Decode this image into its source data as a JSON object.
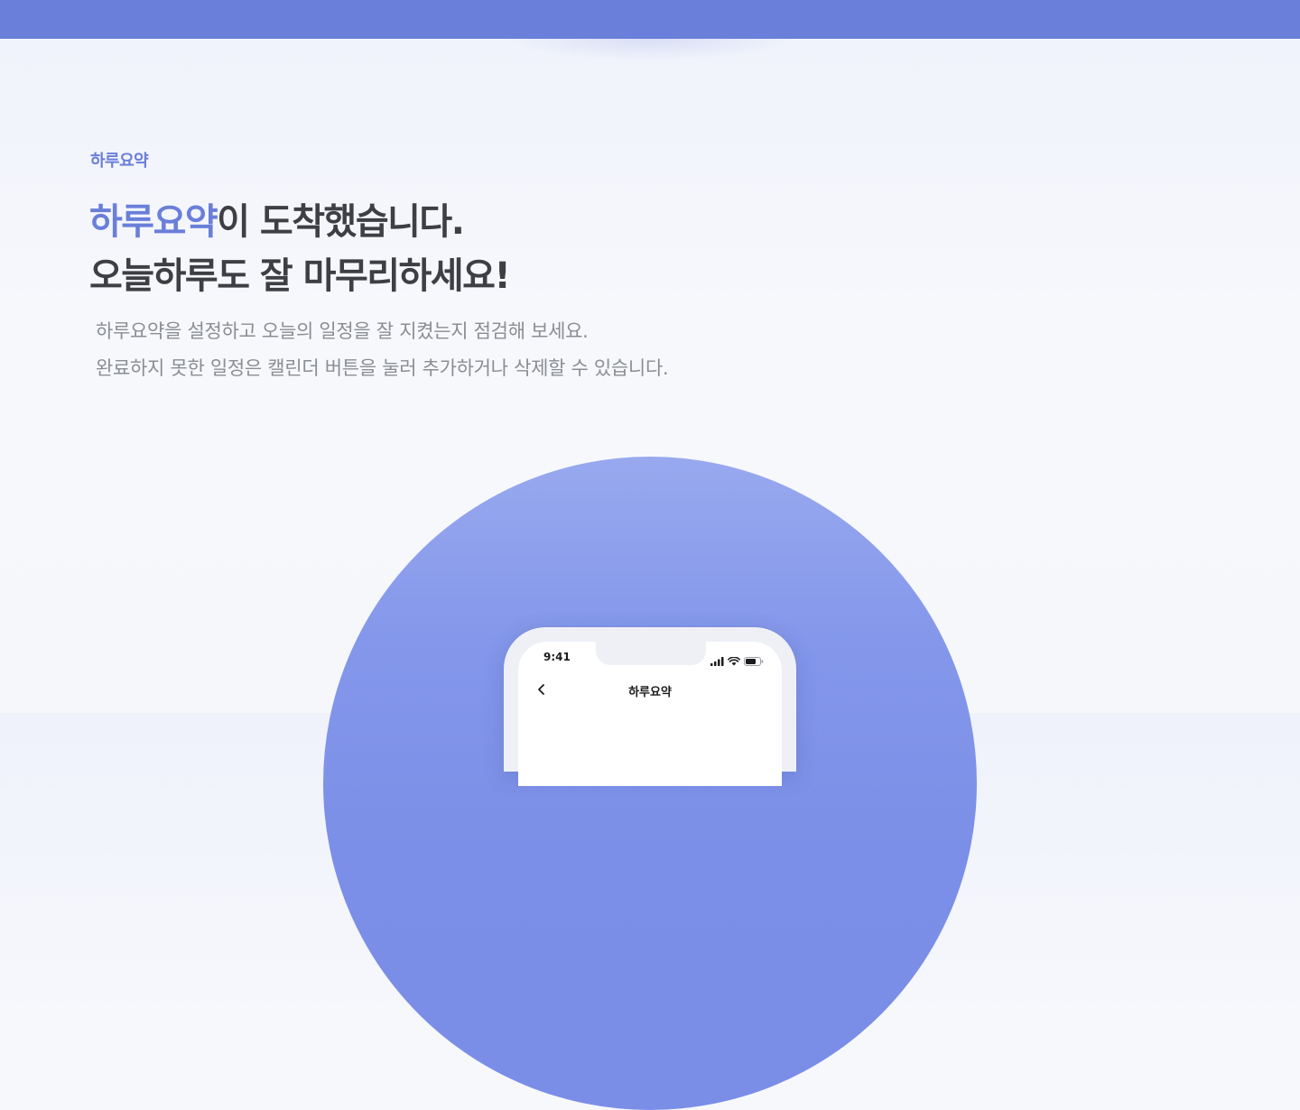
{
  "hero": {
    "eyebrow": "하루요약",
    "headline_accent": "하루요약",
    "headline_line1_rest": "이 도착했습니다.",
    "headline_line2": "오늘하루도 잘 마무리하세요!",
    "description": [
      "하루요약을 설정하고 오늘의 일정을 잘 지켰는지 점검해 보세요.",
      "완료하지 못한 일정은 캘린더 버튼을 눌러 추가하거나 삭제할 수 있습니다."
    ]
  },
  "phone": {
    "status_time": "9:41",
    "status_icons": [
      "signal-icon",
      "wifi-icon",
      "battery-icon"
    ],
    "nav_back_icon": "chevron-left-icon",
    "nav_title": "하루요약"
  },
  "colors": {
    "accent": "#6a7fd9",
    "headline": "#3d3f44",
    "body_text": "#8a8d94",
    "circle": "#7b8fe8"
  }
}
